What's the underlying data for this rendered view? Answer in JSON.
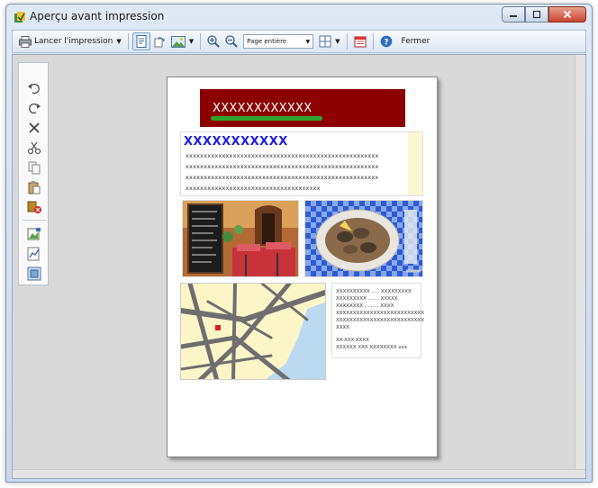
{
  "window": {
    "title": "Aperçu avant impression"
  },
  "toolbar": {
    "print_label": "Lancer l'impression",
    "zoom_value": "Page entière",
    "close_label": "Fermer"
  },
  "page": {
    "banner_text": "XXXXXXXXXXXX",
    "heading": "XXXXXXXXXXX",
    "body_lines": [
      "xxxxxxxxxxxxxxxxxxxxxxxxxxxxxxxxxxxxxxxxxxxxxxxxxxxxx",
      "xxxxxxxxxxxxxxxxxxxxxxxxxxxxxxxxxxxxxxxxxxxxxxxxxxxxx",
      "xxxxxxxxxxxxxxxxxxxxxxxxxxxxxxxxxxxxxxxxxxxxxxxxxxxxx",
      "xxxxxxxxxxxxxxxxxxxxxxxxxxxxxxxxxxxxx"
    ],
    "address_lines": [
      "XXXXXXXXXX ..... XXXXXXXXX",
      "XXXXXXXXX ....... XXXXX",
      "XXXXXXXX ......... XXXX",
      "XXXXXXXXXXXXXXXXXXXXXXXXXX",
      "XXXXXXXXXXXXXXXXXXXXXXXXXX",
      "XXXX",
      "XX-XXX-XXXX",
      "XXXXXX XXX XXXXXXXX xxx"
    ]
  },
  "colors": {
    "banner": "#8c0000",
    "heading": "#1f1fe0",
    "banner_underline": "#2ea52e"
  },
  "icons": {
    "toolbar": [
      "printer-icon",
      "single-page-icon",
      "rotate-icon",
      "image-icon",
      "zoom-in-icon",
      "zoom-out-icon",
      "grid-icon",
      "calendar-icon",
      "help-icon"
    ],
    "sidebar": [
      "undo-icon",
      "redo-icon",
      "delete-icon",
      "cut-icon",
      "copy-icon",
      "paste-icon",
      "clear-icon",
      "image-edit-icon",
      "chart-icon",
      "picture-icon"
    ]
  }
}
